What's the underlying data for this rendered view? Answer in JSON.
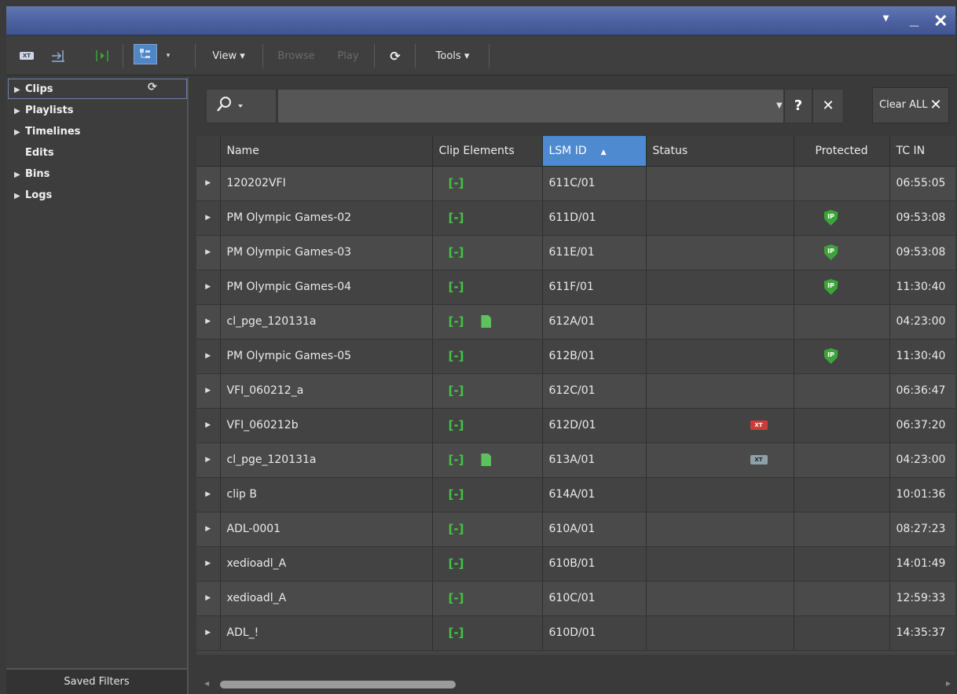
{
  "window": {
    "menu_glyph": "▾",
    "minimize_glyph": "_",
    "close_glyph": "✕"
  },
  "toolbar": {
    "xt_label": "XT",
    "view_label": "View ▾",
    "browse_label": "Browse",
    "play_label": "Play",
    "tools_label": "Tools ▾"
  },
  "sidebar": {
    "items": [
      {
        "label": "Clips",
        "expandable": true
      },
      {
        "label": "Playlists",
        "expandable": true
      },
      {
        "label": "Timelines",
        "expandable": true
      },
      {
        "label": "Edits",
        "expandable": false
      },
      {
        "label": "Bins",
        "expandable": true
      },
      {
        "label": "Logs",
        "expandable": true
      }
    ],
    "saved_filters_label": "Saved Filters"
  },
  "search": {
    "value": "",
    "help_label": "?",
    "clear_label": "✕",
    "clear_all_label": "Clear ALL"
  },
  "table": {
    "columns": [
      "",
      "Name",
      "Clip Elements",
      "LSM ID",
      "Status",
      "Protected",
      "TC IN"
    ],
    "sorted_column": "LSM ID",
    "sort_direction": "asc",
    "rows": [
      {
        "name": "120202VFI",
        "doc": false,
        "lsm_id": "611C/01",
        "status": "",
        "protected": false,
        "tc_in": "06:55:05"
      },
      {
        "name": "PM Olympic Games-02",
        "doc": false,
        "lsm_id": "611D/01",
        "status": "",
        "protected": true,
        "tc_in": "09:53:08"
      },
      {
        "name": "PM Olympic Games-03",
        "doc": false,
        "lsm_id": "611E/01",
        "status": "",
        "protected": true,
        "tc_in": "09:53:08"
      },
      {
        "name": "PM Olympic Games-04",
        "doc": false,
        "lsm_id": "611F/01",
        "status": "",
        "protected": true,
        "tc_in": "11:30:40"
      },
      {
        "name": "cl_pge_120131a",
        "doc": true,
        "lsm_id": "612A/01",
        "status": "",
        "protected": false,
        "tc_in": "04:23:00"
      },
      {
        "name": "PM Olympic Games-05",
        "doc": false,
        "lsm_id": "612B/01",
        "status": "",
        "protected": true,
        "tc_in": "11:30:40"
      },
      {
        "name": "VFI_060212_a",
        "doc": false,
        "lsm_id": "612C/01",
        "status": "",
        "protected": false,
        "tc_in": "06:36:47"
      },
      {
        "name": "VFI_060212b",
        "doc": false,
        "lsm_id": "612D/01",
        "status": "xt-red",
        "protected": false,
        "tc_in": "06:37:20"
      },
      {
        "name": "cl_pge_120131a",
        "doc": true,
        "lsm_id": "613A/01",
        "status": "xt-gray",
        "protected": false,
        "tc_in": "04:23:00"
      },
      {
        "name": "clip B",
        "doc": false,
        "lsm_id": "614A/01",
        "status": "",
        "protected": false,
        "tc_in": "10:01:36"
      },
      {
        "name": "ADL-0001",
        "doc": false,
        "lsm_id": "610A/01",
        "status": "",
        "protected": false,
        "tc_in": "08:27:23"
      },
      {
        "name": "xedioadl_A",
        "doc": false,
        "lsm_id": "610B/01",
        "status": "",
        "protected": false,
        "tc_in": "14:01:49"
      },
      {
        "name": "xedioadl_A",
        "doc": false,
        "lsm_id": "610C/01",
        "status": "",
        "protected": false,
        "tc_in": "12:59:33"
      },
      {
        "name": "ADL_!",
        "doc": false,
        "lsm_id": "610D/01",
        "status": "",
        "protected": false,
        "tc_in": "14:35:37"
      }
    ]
  },
  "icons": {
    "clip_element": "clip-element-icon",
    "document": "document-icon",
    "protected": "protected-shield-icon",
    "status_xt": "xt-status-icon"
  },
  "colors": {
    "title_bar": "#4a5f9e",
    "sort_header": "#4e8ad0",
    "clip_green": "#42c442",
    "shield_green": "#3aa63a",
    "status_red": "#d23a3a"
  }
}
